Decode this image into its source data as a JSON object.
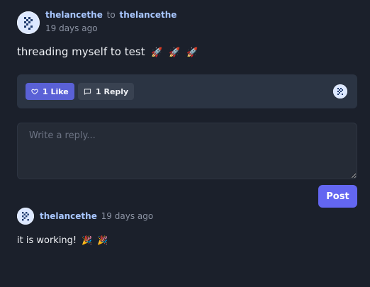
{
  "post": {
    "author": "thelancethe",
    "to_word": "to",
    "recipient": "thelancethe",
    "time": "19 days ago",
    "body": "threading myself to test",
    "body_icons": [
      "rocket-emoji",
      "rocket-emoji",
      "rocket-emoji"
    ]
  },
  "actions": {
    "like_label": "1 Like",
    "reply_label": "1 Reply",
    "like_icon": "heart-outline-icon",
    "reply_icon": "speech-bubble-icon"
  },
  "reply_form": {
    "placeholder": "Write a reply...",
    "submit_label": "Post"
  },
  "replies": [
    {
      "author": "thelancethe",
      "time": "19 days ago",
      "body": "it is working!",
      "body_icons": [
        "party-popper-emoji",
        "party-popper-emoji"
      ]
    }
  ],
  "colors": {
    "background": "#1b202b",
    "accent": "#6366f1",
    "like_button": "#5a61d6",
    "author_link": "#a9c7ff"
  }
}
